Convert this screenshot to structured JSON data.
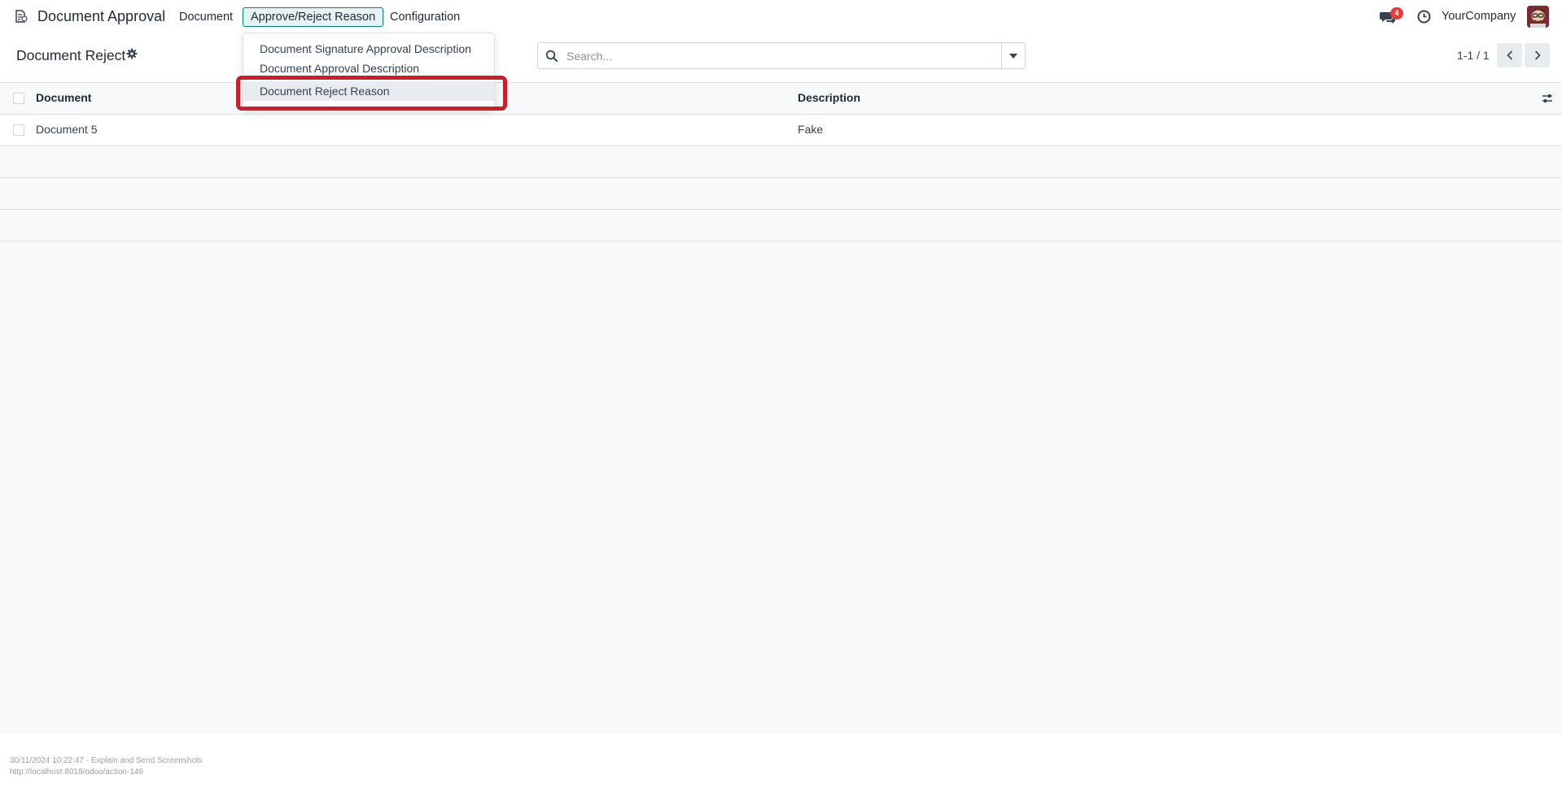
{
  "navbar": {
    "app_title": "Document Approval",
    "menu": [
      {
        "label": "Document"
      },
      {
        "label": "Approve/Reject Reason"
      },
      {
        "label": "Configuration"
      }
    ],
    "messages_badge": "4",
    "company": "YourCompany",
    "accent_color": "#017e84"
  },
  "dropdown": {
    "items": [
      {
        "label": "Document Signature Approval Description"
      },
      {
        "label": "Document Approval Description"
      },
      {
        "label": "Document Reject Reason"
      }
    ],
    "highlight_color": "#c4212a"
  },
  "control_panel": {
    "title": "Document Reject",
    "search_placeholder": "Search...",
    "pager": "1-1 / 1"
  },
  "list": {
    "columns": [
      "Document",
      "Description"
    ],
    "rows": [
      {
        "document": "Document 5",
        "description": "Fake"
      }
    ]
  },
  "footer": {
    "line1": "30/11/2024 10:22:47 - Explain and Send Screenshots",
    "line2": "http://localhost:8018/odoo/action-146"
  }
}
